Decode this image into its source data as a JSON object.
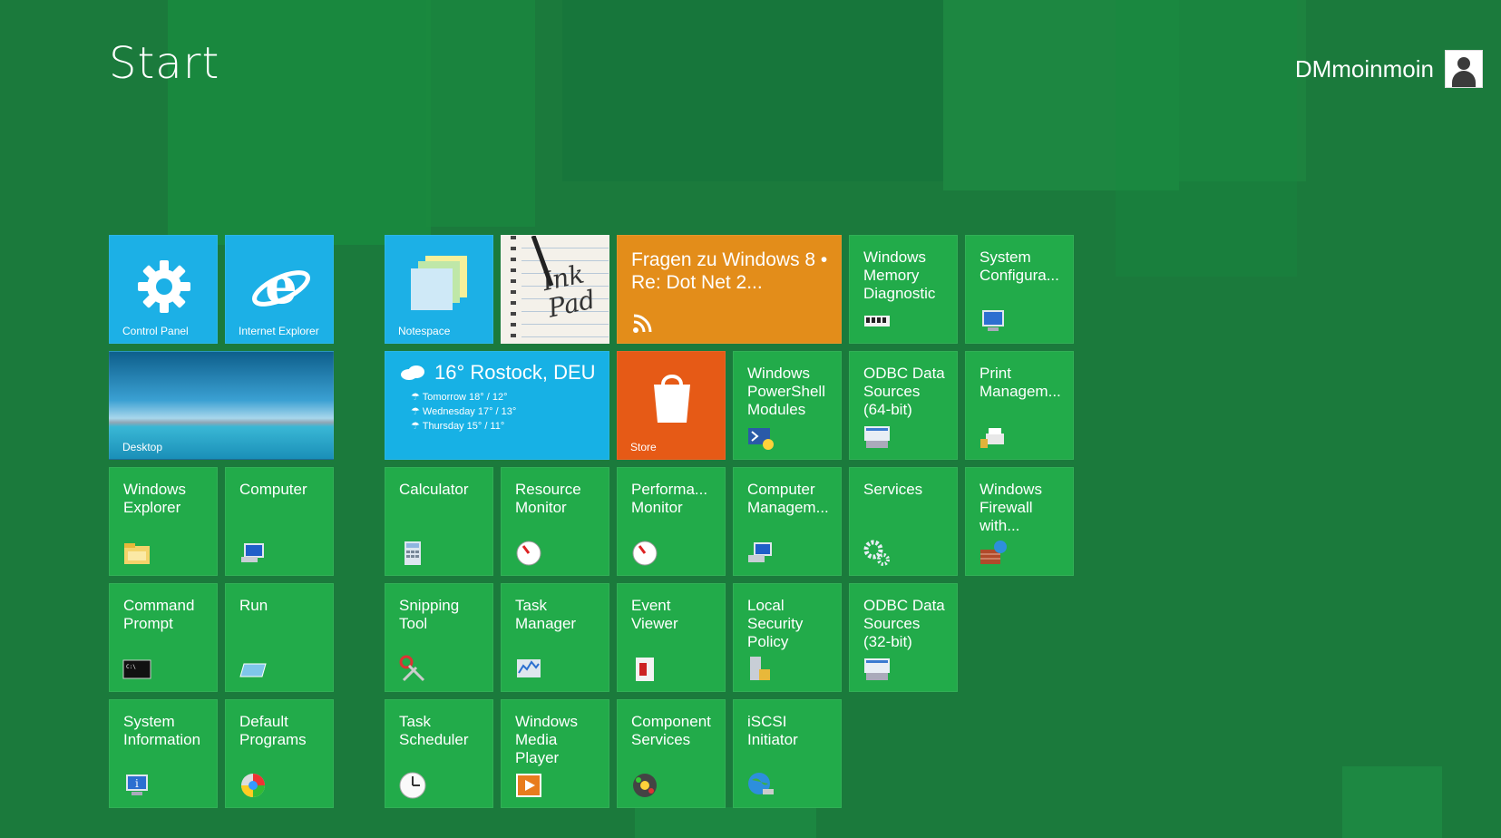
{
  "header": {
    "title": "Start",
    "username": "DMmoinmoin"
  },
  "tiles": {
    "control_panel": "Control Panel",
    "internet_explorer": "Internet Explorer",
    "desktop": "Desktop",
    "notespace": "Notespace",
    "inkpad_text": "Ink Pad",
    "rss": "Fragen zu Windows 8 • Re: Dot Net 2...",
    "mem_diag": "Windows\nMemory\nDiagnostic",
    "sys_config": "System\nConfigura...",
    "weather": {
      "title": "16° Rostock, DEU",
      "rows": [
        "Tomorrow 18° / 12°",
        "Wednesday 17° / 13°",
        "Thursday  15° / 11°"
      ]
    },
    "store": "Store",
    "powershell": "Windows\nPowerShell\nModules",
    "odbc64": "ODBC Data\nSources\n(64-bit)",
    "print_mgmt": "Print\nManagem...",
    "win_explorer": "Windows\nExplorer",
    "computer": "Computer",
    "calculator": "Calculator",
    "resource_monitor": "Resource\nMonitor",
    "perf_monitor": "Performa...\nMonitor",
    "comp_mgmt": "Computer\nManagem...",
    "services": "Services",
    "firewall": "Windows\nFirewall\nwith...",
    "cmd": "Command\nPrompt",
    "run": "Run",
    "snipping": "Snipping\nTool",
    "task_manager": "Task\nManager",
    "event_viewer": "Event\nViewer",
    "local_sec": "Local\nSecurity\nPolicy",
    "odbc32": "ODBC Data\nSources\n(32-bit)",
    "sysinfo": "System\nInformation",
    "default_programs": "Default\nPrograms",
    "task_scheduler": "Task\nScheduler",
    "wmp": "Windows\nMedia\nPlayer",
    "component_services": "Component\nServices",
    "iscsi": "iSCSI\nInitiator"
  },
  "colors": {
    "background": "#1b7a3c",
    "tile_green": "#22ab4a",
    "tile_blue": "#1cb0e6",
    "tile_orange": "#e38d1a",
    "tile_store": "#e65a16"
  },
  "icons": {
    "control_panel": "gear-icon",
    "internet_explorer": "ie-icon",
    "rss": "rss-icon",
    "weather": "cloud-icon",
    "store": "shopping-bag-icon"
  }
}
